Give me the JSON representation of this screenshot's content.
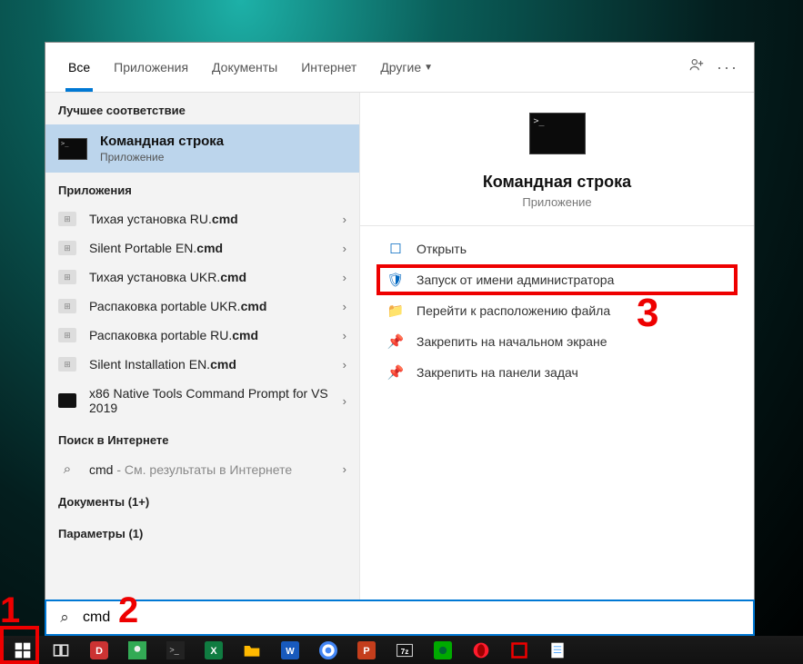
{
  "tabs": {
    "all": "Все",
    "apps": "Приложения",
    "docs": "Документы",
    "internet": "Интернет",
    "other": "Другие"
  },
  "sections": {
    "best_match": "Лучшее соответствие",
    "apps": "Приложения",
    "web": "Поиск в Интернете",
    "documents": "Документы (1+)",
    "settings": "Параметры (1)"
  },
  "best": {
    "title": "Командная строка",
    "subtitle": "Приложение"
  },
  "app_items": [
    {
      "pre": "Тихая установка RU.",
      "bold": "cmd"
    },
    {
      "pre": "Silent Portable EN.",
      "bold": "cmd"
    },
    {
      "pre": "Тихая установка UKR.",
      "bold": "cmd"
    },
    {
      "pre": "Распаковка portable UKR.",
      "bold": "cmd"
    },
    {
      "pre": "Распаковка portable RU.",
      "bold": "cmd"
    },
    {
      "pre": "Silent Installation EN.",
      "bold": "cmd"
    },
    {
      "pre": "x86 Native Tools Command Prompt for VS 2019",
      "bold": ""
    }
  ],
  "web_search": {
    "query": "cmd",
    "suffix": " - См. результаты в Интернете"
  },
  "preview": {
    "title": "Командная строка",
    "subtitle": "Приложение"
  },
  "actions": {
    "open": "Открыть",
    "run_admin": "Запуск от имени администратора",
    "open_location": "Перейти к расположению файла",
    "pin_start": "Закрепить на начальном экране",
    "pin_taskbar": "Закрепить на панели задач"
  },
  "search_value": "cmd",
  "callouts": {
    "c1": "1",
    "c2": "2",
    "c3": "3"
  }
}
